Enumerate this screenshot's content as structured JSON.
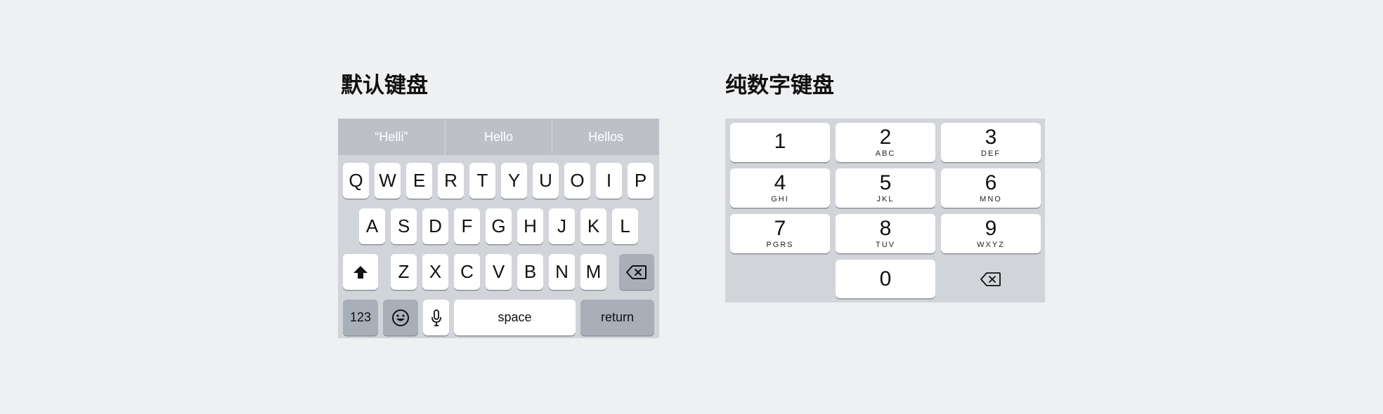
{
  "default_keyboard": {
    "title": "默认键盘",
    "suggestions": [
      "“Helli”",
      "Hello",
      "Hellos"
    ],
    "row1": [
      "Q",
      "W",
      "E",
      "R",
      "T",
      "Y",
      "U",
      "O",
      "I",
      "P"
    ],
    "row2": [
      "A",
      "S",
      "D",
      "F",
      "G",
      "H",
      "J",
      "K",
      "L"
    ],
    "row3": [
      "Z",
      "X",
      "C",
      "V",
      "B",
      "N",
      "M"
    ],
    "numbers_label": "123",
    "space_label": "space",
    "return_label": "return",
    "icons": [
      "shift-icon",
      "backspace-icon",
      "emoji-icon",
      "microphone-icon"
    ]
  },
  "numeric_keyboard": {
    "title": "纯数字键盘",
    "keys": [
      {
        "digit": "1",
        "letters": ""
      },
      {
        "digit": "2",
        "letters": "ABC"
      },
      {
        "digit": "3",
        "letters": "DEF"
      },
      {
        "digit": "4",
        "letters": "GHI"
      },
      {
        "digit": "5",
        "letters": "JKL"
      },
      {
        "digit": "6",
        "letters": "MNO"
      },
      {
        "digit": "7",
        "letters": "PGRS"
      },
      {
        "digit": "8",
        "letters": "TUV"
      },
      {
        "digit": "9",
        "letters": "WXYZ"
      }
    ],
    "zero": "0",
    "icons": [
      "backspace-icon"
    ]
  }
}
